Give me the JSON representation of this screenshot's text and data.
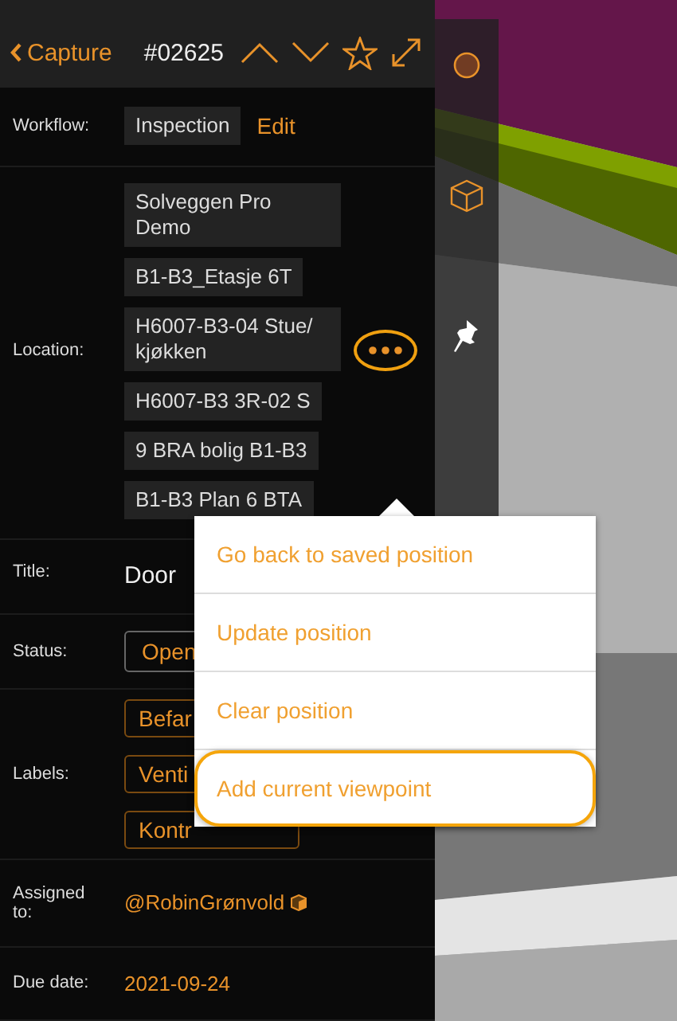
{
  "header": {
    "back_label": "Capture",
    "id": "#02625"
  },
  "fields": [
    {
      "kind": "workflow",
      "label": "Workflow:",
      "value": "Inspection",
      "action": "Edit"
    },
    {
      "kind": "location",
      "label": "Location:",
      "values": [
        "Solveggen Pro Demo",
        "B1-B3_Etasje 6T",
        "H6007-B3-04 Stue/ kjøkken",
        "H6007-B3 3R-02 S",
        "9 BRA bolig B1-B3",
        "B1-B3 Plan 6 BTA"
      ]
    },
    {
      "kind": "text",
      "label": "Title:",
      "value": "Door"
    },
    {
      "kind": "status",
      "label": "Status:",
      "value": "Open"
    },
    {
      "kind": "tags",
      "label": "Labels:",
      "values": [
        "Befar",
        "Venti",
        "Kontr"
      ]
    },
    {
      "kind": "user",
      "label": "Assigned to:",
      "value": "@RobinGrønvold"
    },
    {
      "kind": "date",
      "label": "Due date:",
      "value": "2021-09-24"
    }
  ],
  "menu": {
    "items": [
      {
        "label": "Go back to saved position",
        "selected": false
      },
      {
        "label": "Update position",
        "selected": false
      },
      {
        "label": "Clear position",
        "selected": false
      },
      {
        "label": "Add current viewpoint",
        "selected": true
      }
    ]
  }
}
